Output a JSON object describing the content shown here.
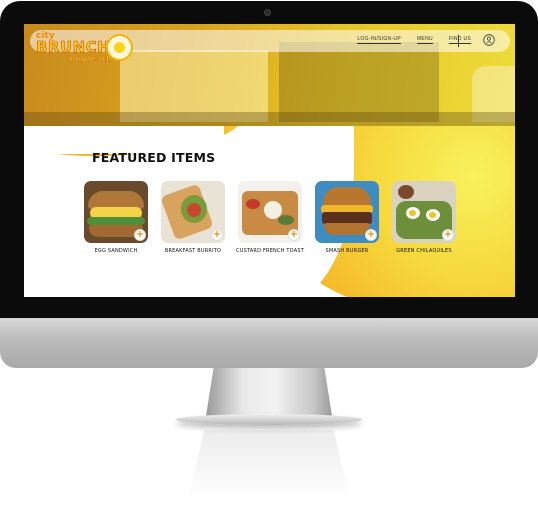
{
  "nav": {
    "links": [
      "LOG-IN/SIGN-UP",
      "MENU",
      "FIND US"
    ]
  },
  "logo": {
    "line1": "city",
    "line2": "BRUNCH",
    "line3": "long beach"
  },
  "featured": {
    "title": "FEATURED ITEMS",
    "add_symbol": "+",
    "items": [
      {
        "name": "EGG SANDWICH"
      },
      {
        "name": "BREAKFAST BURRITO"
      },
      {
        "name": "CUSTARD FRENCH TOAST"
      },
      {
        "name": "SMASH BURGER"
      },
      {
        "name": "GREEN CHILAQUILES"
      }
    ]
  },
  "colors": {
    "accent": "#f5b82a",
    "highlight": "#f8f25e",
    "plus": "#f08a0a"
  },
  "icons": {
    "user": "user-circle-icon",
    "add": "plus-icon",
    "camera": "camera-dot"
  }
}
